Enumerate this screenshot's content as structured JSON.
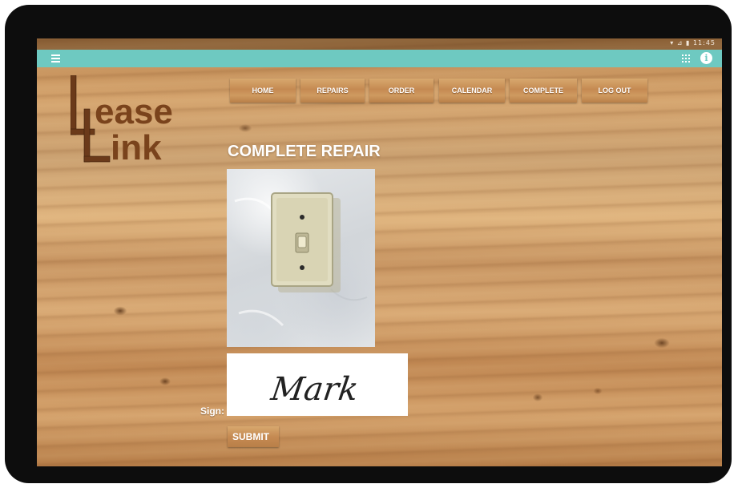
{
  "status_bar": {
    "time": "▾ ⊿ ▮ 11:45"
  },
  "logo": {
    "line1": "ease",
    "line2": "ink",
    "initial1": "L",
    "initial2": "L"
  },
  "nav": {
    "items": [
      {
        "label": "HOME"
      },
      {
        "label": "REPAIRS"
      },
      {
        "label": "ORDER"
      },
      {
        "label": "CALENDAR"
      },
      {
        "label": "COMPLETE"
      },
      {
        "label": "LOG OUT"
      }
    ]
  },
  "page": {
    "title": "COMPLETE REPAIR"
  },
  "signature": {
    "label": "Sign:",
    "signed_name": "Mark"
  },
  "form": {
    "submit_label": "SUBMIT"
  },
  "colors": {
    "app_bar": "#6ec9c1",
    "logo_brown": "#6b3a1a",
    "button_wood": "#c58a52"
  },
  "icons": {
    "menu": "menu-icon",
    "apps": "grid-icon",
    "info": "info-icon"
  }
}
